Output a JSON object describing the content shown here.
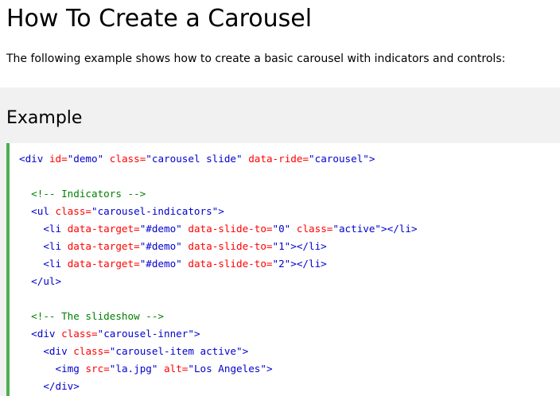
{
  "page": {
    "title": "How To Create a Carousel",
    "intro": "The following example shows how to create a basic carousel with indicators and controls:"
  },
  "example": {
    "heading": "Example"
  },
  "colors": {
    "accent_border": "#4caf50",
    "panel_bg": "#f1f1f1",
    "tag": "#0000cd",
    "attribute": "#ff0000",
    "value": "#0000cd",
    "comment": "#008000"
  },
  "code": {
    "lines": [
      [
        {
          "k": "tag",
          "t": "<div"
        },
        {
          "k": "txt",
          "t": " "
        },
        {
          "k": "attr",
          "t": "id="
        },
        {
          "k": "val",
          "t": "\"demo\""
        },
        {
          "k": "txt",
          "t": " "
        },
        {
          "k": "attr",
          "t": "class="
        },
        {
          "k": "val",
          "t": "\"carousel slide\""
        },
        {
          "k": "txt",
          "t": " "
        },
        {
          "k": "attr",
          "t": "data-ride="
        },
        {
          "k": "val",
          "t": "\"carousel\""
        },
        {
          "k": "tag",
          "t": ">"
        }
      ],
      [],
      [
        {
          "k": "txt",
          "t": "  "
        },
        {
          "k": "cmt",
          "t": "<!-- Indicators -->"
        }
      ],
      [
        {
          "k": "txt",
          "t": "  "
        },
        {
          "k": "tag",
          "t": "<ul"
        },
        {
          "k": "txt",
          "t": " "
        },
        {
          "k": "attr",
          "t": "class="
        },
        {
          "k": "val",
          "t": "\"carousel-indicators\""
        },
        {
          "k": "tag",
          "t": ">"
        }
      ],
      [
        {
          "k": "txt",
          "t": "    "
        },
        {
          "k": "tag",
          "t": "<li"
        },
        {
          "k": "txt",
          "t": " "
        },
        {
          "k": "attr",
          "t": "data-target="
        },
        {
          "k": "val",
          "t": "\"#demo\""
        },
        {
          "k": "txt",
          "t": " "
        },
        {
          "k": "attr",
          "t": "data-slide-to="
        },
        {
          "k": "val",
          "t": "\"0\""
        },
        {
          "k": "txt",
          "t": " "
        },
        {
          "k": "attr",
          "t": "class="
        },
        {
          "k": "val",
          "t": "\"active\""
        },
        {
          "k": "tag",
          "t": "></li>"
        }
      ],
      [
        {
          "k": "txt",
          "t": "    "
        },
        {
          "k": "tag",
          "t": "<li"
        },
        {
          "k": "txt",
          "t": " "
        },
        {
          "k": "attr",
          "t": "data-target="
        },
        {
          "k": "val",
          "t": "\"#demo\""
        },
        {
          "k": "txt",
          "t": " "
        },
        {
          "k": "attr",
          "t": "data-slide-to="
        },
        {
          "k": "val",
          "t": "\"1\""
        },
        {
          "k": "tag",
          "t": "></li>"
        }
      ],
      [
        {
          "k": "txt",
          "t": "    "
        },
        {
          "k": "tag",
          "t": "<li"
        },
        {
          "k": "txt",
          "t": " "
        },
        {
          "k": "attr",
          "t": "data-target="
        },
        {
          "k": "val",
          "t": "\"#demo\""
        },
        {
          "k": "txt",
          "t": " "
        },
        {
          "k": "attr",
          "t": "data-slide-to="
        },
        {
          "k": "val",
          "t": "\"2\""
        },
        {
          "k": "tag",
          "t": "></li>"
        }
      ],
      [
        {
          "k": "txt",
          "t": "  "
        },
        {
          "k": "tag",
          "t": "</ul>"
        }
      ],
      [],
      [
        {
          "k": "txt",
          "t": "  "
        },
        {
          "k": "cmt",
          "t": "<!-- The slideshow -->"
        }
      ],
      [
        {
          "k": "txt",
          "t": "  "
        },
        {
          "k": "tag",
          "t": "<div"
        },
        {
          "k": "txt",
          "t": " "
        },
        {
          "k": "attr",
          "t": "class="
        },
        {
          "k": "val",
          "t": "\"carousel-inner\""
        },
        {
          "k": "tag",
          "t": ">"
        }
      ],
      [
        {
          "k": "txt",
          "t": "    "
        },
        {
          "k": "tag",
          "t": "<div"
        },
        {
          "k": "txt",
          "t": " "
        },
        {
          "k": "attr",
          "t": "class="
        },
        {
          "k": "val",
          "t": "\"carousel-item active\""
        },
        {
          "k": "tag",
          "t": ">"
        }
      ],
      [
        {
          "k": "txt",
          "t": "      "
        },
        {
          "k": "tag",
          "t": "<img"
        },
        {
          "k": "txt",
          "t": " "
        },
        {
          "k": "attr",
          "t": "src="
        },
        {
          "k": "val",
          "t": "\"la.jpg\""
        },
        {
          "k": "txt",
          "t": " "
        },
        {
          "k": "attr",
          "t": "alt="
        },
        {
          "k": "val",
          "t": "\"Los Angeles\""
        },
        {
          "k": "tag",
          "t": ">"
        }
      ],
      [
        {
          "k": "txt",
          "t": "    "
        },
        {
          "k": "tag",
          "t": "</div>"
        }
      ]
    ]
  }
}
